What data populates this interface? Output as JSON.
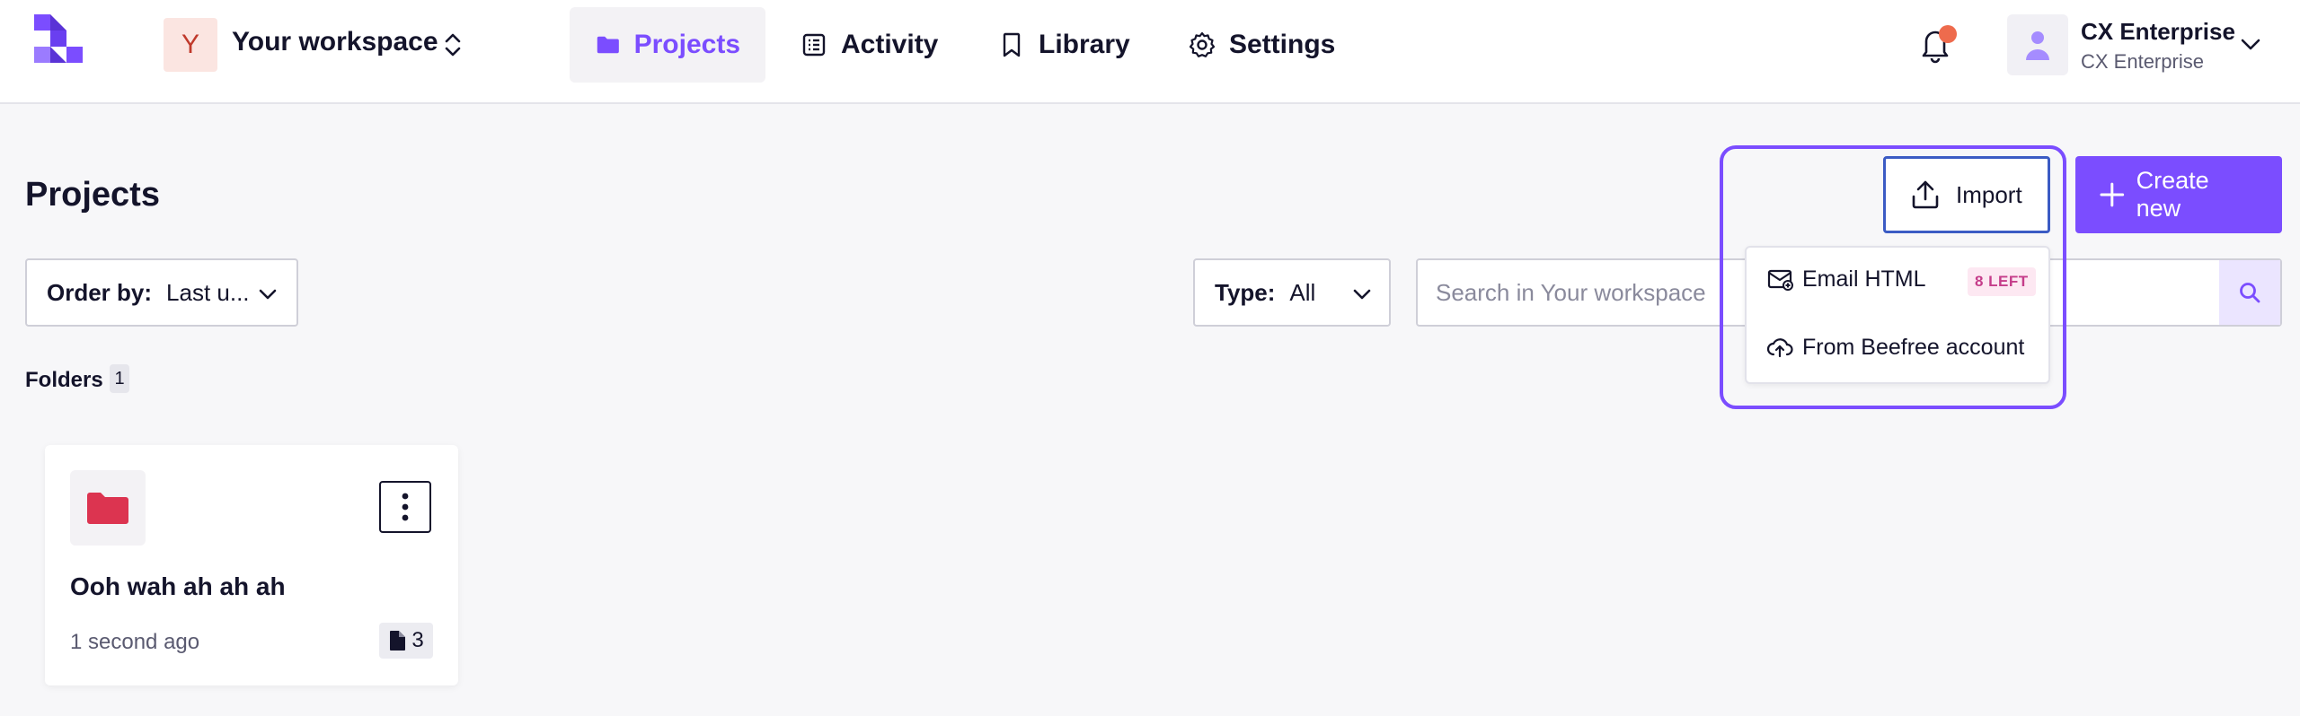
{
  "header": {
    "logo_icon": "beefree-logo-icon",
    "workspace": {
      "avatar_letter": "Y",
      "name": "Your workspace"
    },
    "nav": [
      {
        "label": "Projects",
        "icon": "folder-icon",
        "active": true
      },
      {
        "label": "Activity",
        "icon": "list-icon",
        "active": false
      },
      {
        "label": "Library",
        "icon": "bookmark-icon",
        "active": false
      },
      {
        "label": "Settings",
        "icon": "gear-icon",
        "active": false
      }
    ],
    "notifications_icon": "bell-icon",
    "user": {
      "name": "CX Enterprise",
      "subtitle": "CX Enterprise"
    }
  },
  "main": {
    "title": "Projects",
    "order_by": {
      "label": "Order by:",
      "value": "Last u..."
    },
    "type_filter": {
      "label": "Type:",
      "value": "All"
    },
    "search": {
      "placeholder": "Search in Your workspace"
    },
    "import_button": {
      "label": "Import"
    },
    "create_button": {
      "label": "Create new"
    },
    "import_menu": {
      "items": [
        {
          "label": "Email HTML",
          "icon": "email-html-icon",
          "badge": "8 LEFT"
        },
        {
          "label": "From Beefree account",
          "icon": "cloud-upload-icon"
        }
      ]
    },
    "folders": {
      "label": "Folders",
      "count": "1",
      "items": [
        {
          "name": "Ooh wah ah ah ah",
          "updated": "1 second ago",
          "file_count": "3"
        }
      ]
    }
  },
  "colors": {
    "accent": "#7b4dff",
    "folder": "#dc3450",
    "notification_dot": "#ee6b4d",
    "import_border": "#3b5bc4"
  }
}
